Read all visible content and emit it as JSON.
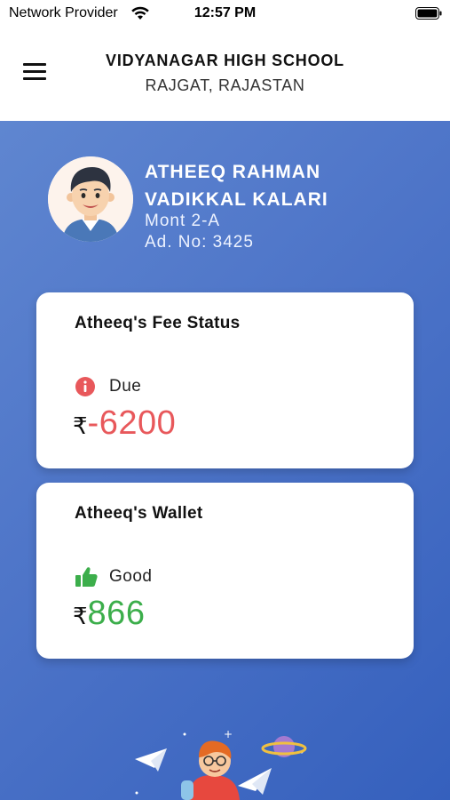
{
  "status_bar": {
    "carrier": "Network Provider",
    "time": "12:57 PM",
    "wifi_icon": "wifi-icon",
    "battery_icon": "battery-icon"
  },
  "header": {
    "menu_icon": "hamburger-menu-icon",
    "school_name": "VIDYANAGAR HIGH SCHOOL",
    "school_location": "RAJGAT, RAJASTAN"
  },
  "student": {
    "name_line1": "ATHEEQ RAHMAN",
    "name_line2": "VADIKKAL KALARI",
    "class": "Mont 2-A",
    "admission": "Ad. No:  3425",
    "avatar_icon": "student-avatar"
  },
  "fee_card": {
    "title": "Atheeq's Fee Status",
    "status_icon": "info-icon",
    "status_label": "Due",
    "currency": "₹",
    "amount": "-6200",
    "amount_color": "#e8585b"
  },
  "wallet_card": {
    "title": "Atheeq's Wallet",
    "status_icon": "thumbs-up-icon",
    "status_label": "Good",
    "currency": "₹",
    "amount": "866",
    "amount_color": "#3cae4b"
  },
  "colors": {
    "background_start": "#5f86d0",
    "background_end": "#3560bd",
    "due_icon": "#e8585b",
    "good_icon": "#3cae4b"
  },
  "illustration": "kid-rocket-illustration"
}
